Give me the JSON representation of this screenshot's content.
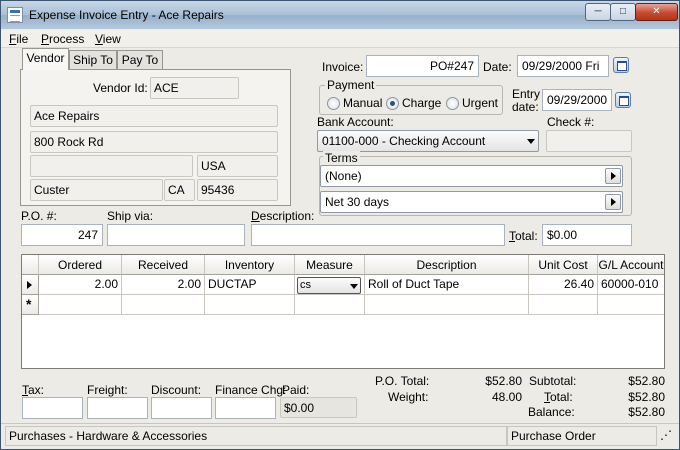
{
  "window": {
    "title": "Expense Invoice Entry - Ace Repairs",
    "minimize": "─",
    "maximize": "□",
    "close": "✕"
  },
  "menu": [
    "File",
    "Process",
    "View"
  ],
  "tabs": [
    "Vendor",
    "Ship To",
    "Pay To"
  ],
  "vendor": {
    "id_label": "Vendor Id:",
    "id": "ACE",
    "name": "Ace Repairs",
    "address1": "800 Rock Rd",
    "address2": "",
    "country": "USA",
    "city": "Custer",
    "state": "CA",
    "zip": "95436"
  },
  "invoice": {
    "invoice_label": "Invoice:",
    "invoice_no": "PO#247",
    "date_label": "Date:",
    "date": "09/29/2000 Fri",
    "payment_label": "Payment",
    "payment_options": [
      "Manual",
      "Charge",
      "Urgent"
    ],
    "payment_selected": "Charge",
    "entry_date_label_1": "Entry",
    "entry_date_label_2": "date:",
    "entry_date": "09/29/2000",
    "bank_account_label": "Bank Account:",
    "bank_account": "01100-000 - Checking Account",
    "check_label": "Check #:",
    "check_no": "",
    "terms_label": "Terms",
    "terms_1": "(None)",
    "terms_2": "Net  30 days"
  },
  "po": {
    "po_label": "P.O. #:",
    "po_no": "247",
    "ship_via_label": "Ship via:",
    "ship_via": "",
    "description_label": "Description:",
    "description": "",
    "total_label": "Total:",
    "total": "$0.00"
  },
  "grid": {
    "columns": [
      "Ordered",
      "Received",
      "Inventory",
      "Measure",
      "Description",
      "Unit Cost",
      "G/L Account"
    ],
    "rows": [
      {
        "ordered": "2.00",
        "received": "2.00",
        "inventory": "DUCTAP",
        "measure": "cs",
        "description": "Roll of Duct Tape",
        "unit_cost": "26.40",
        "gl_account": "60000-010"
      }
    ],
    "new_row_marker": "*"
  },
  "footer": {
    "tax_label": "Tax:",
    "freight_label": "Freight:",
    "discount_label": "Discount:",
    "finance_label": "Finance Chg:",
    "paid_label": "Paid:",
    "paid": "$0.00",
    "po_total_label": "P.O. Total:",
    "po_total": "$52.80",
    "weight_label": "Weight:",
    "weight": "48.00",
    "subtotal_label": "Subtotal:",
    "subtotal": "$52.80",
    "total_label": "Total:",
    "total": "$52.80",
    "balance_label": "Balance:",
    "balance": "$52.80"
  },
  "status": {
    "left": "Purchases - Hardware & Accessories",
    "right": "Purchase Order"
  }
}
